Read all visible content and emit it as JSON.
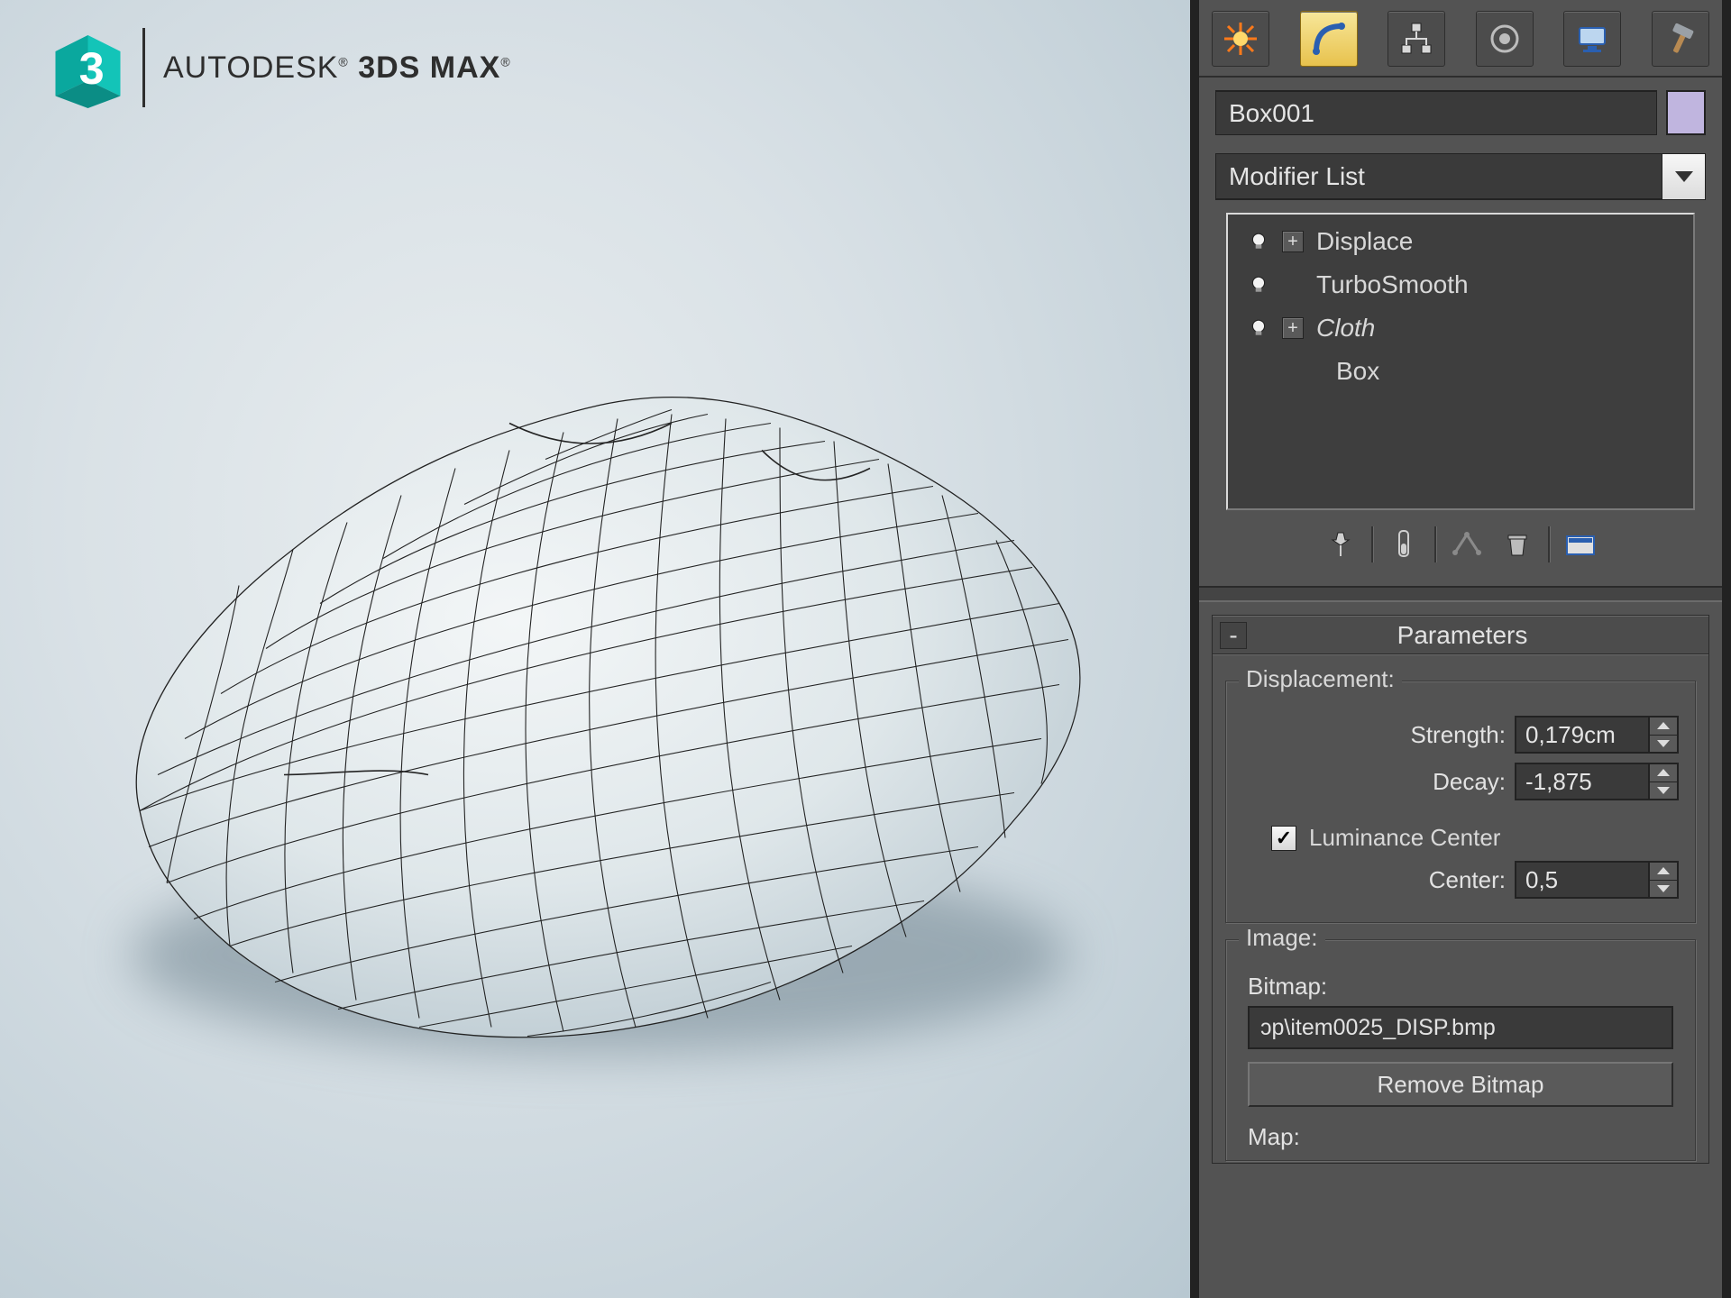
{
  "app": {
    "brand_prefix": "AUTODESK",
    "brand_name": "3DS MAX"
  },
  "panel": {
    "tabs": {
      "create": "create-icon",
      "modify": "modify-icon",
      "hierarchy": "hierarchy-icon",
      "motion": "motion-icon",
      "display": "display-icon",
      "utilities": "utilities-icon"
    },
    "object_name": "Box001",
    "modifier_dropdown": "Modifier List",
    "modifier_stack": [
      {
        "name": "Displace",
        "has_sub": true,
        "italic": false,
        "has_bulb": true
      },
      {
        "name": "TurboSmooth",
        "has_sub": false,
        "italic": false,
        "has_bulb": true
      },
      {
        "name": "Cloth",
        "has_sub": true,
        "italic": true,
        "has_bulb": true
      },
      {
        "name": "Box",
        "has_sub": false,
        "italic": false,
        "has_bulb": false
      }
    ],
    "stack_tool_names": [
      "pin-icon",
      "vial-icon",
      "show-end-result-icon",
      "make-unique-icon",
      "configure-icon"
    ],
    "parameters": {
      "rollout_title": "Parameters",
      "displacement": {
        "group_title": "Displacement:",
        "strength_label": "Strength:",
        "strength_value": "0,179cm",
        "decay_label": "Decay:",
        "decay_value": "-1,875",
        "luminance_center_checked": true,
        "luminance_center_label": "Luminance Center",
        "center_label": "Center:",
        "center_value": "0,5"
      },
      "image": {
        "group_title": "Image:",
        "bitmap_label": "Bitmap:",
        "bitmap_path": "ɔp\\item0025_DISP.bmp",
        "remove_bitmap": "Remove Bitmap",
        "map_label": "Map:"
      }
    }
  }
}
